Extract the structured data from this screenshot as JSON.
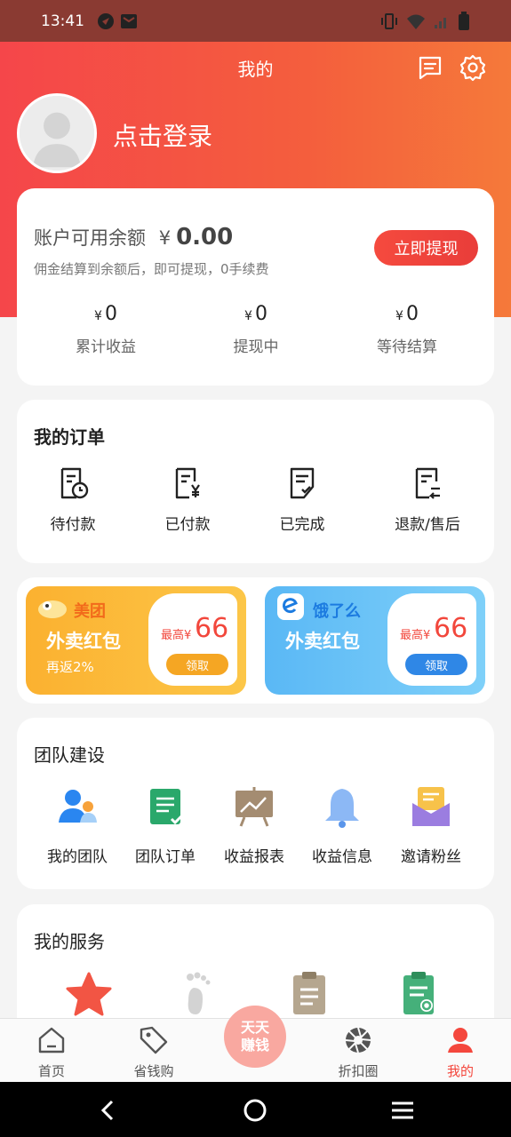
{
  "status_bar": {
    "time": "13:41"
  },
  "header": {
    "title": "我的"
  },
  "profile": {
    "login_text": "点击登录"
  },
  "balance": {
    "label": "账户可用余额",
    "currency": "¥",
    "amount": "0.00",
    "note": "佣金结算到余额后，即可提现，0手续费",
    "withdraw_label": "立即提现",
    "stats": [
      {
        "currency": "¥",
        "value": "0",
        "label": "累计收益"
      },
      {
        "currency": "¥",
        "value": "0",
        "label": "提现中"
      },
      {
        "currency": "¥",
        "value": "0",
        "label": "等待结算"
      }
    ]
  },
  "orders": {
    "title": "我的订单",
    "items": [
      {
        "label": "待付款",
        "icon": "clock-document-icon"
      },
      {
        "label": "已付款",
        "icon": "yen-document-icon"
      },
      {
        "label": "已完成",
        "icon": "check-document-icon"
      },
      {
        "label": "退款/售后",
        "icon": "return-document-icon"
      }
    ]
  },
  "promos": [
    {
      "brand": "美团",
      "title": "外卖红包",
      "sub": "再返2%",
      "max_label": "最高¥",
      "max_value": "66",
      "button": "领取",
      "color": "#fbb531",
      "button_color": "#f5a623",
      "brand_color": "#f26a1b"
    },
    {
      "brand": "饿了么",
      "title": "外卖红包",
      "sub": "",
      "max_label": "最高¥",
      "max_value": "66",
      "button": "领取",
      "color": "#6cc3f7",
      "button_color": "#2f87e6",
      "brand_color": "#1c7be0"
    }
  ],
  "team": {
    "title": "团队建设",
    "items": [
      {
        "label": "我的团队",
        "icon": "team-people-icon"
      },
      {
        "label": "团队订单",
        "icon": "team-order-icon"
      },
      {
        "label": "收益报表",
        "icon": "earnings-chart-icon"
      },
      {
        "label": "收益信息",
        "icon": "notification-bell-icon"
      },
      {
        "label": "邀请粉丝",
        "icon": "invite-mail-icon"
      }
    ]
  },
  "services": {
    "title": "我的服务",
    "items": [
      {
        "icon": "star-icon"
      },
      {
        "icon": "footprint-icon"
      },
      {
        "icon": "clipboard-icon"
      },
      {
        "icon": "search-clipboard-icon"
      }
    ]
  },
  "bottom_nav": {
    "tabs": [
      {
        "label": "首页",
        "icon": "home-icon",
        "active": false
      },
      {
        "label": "省钱购",
        "icon": "tag-icon",
        "active": false
      },
      {
        "label": "折扣圈",
        "icon": "aperture-icon",
        "active": false
      },
      {
        "label": "我的",
        "icon": "person-icon",
        "active": true
      }
    ],
    "center_label_line1": "天天",
    "center_label_line2": "赚钱"
  },
  "colors": {
    "accent": "#f4473d",
    "active_tab": "#f4473d"
  }
}
